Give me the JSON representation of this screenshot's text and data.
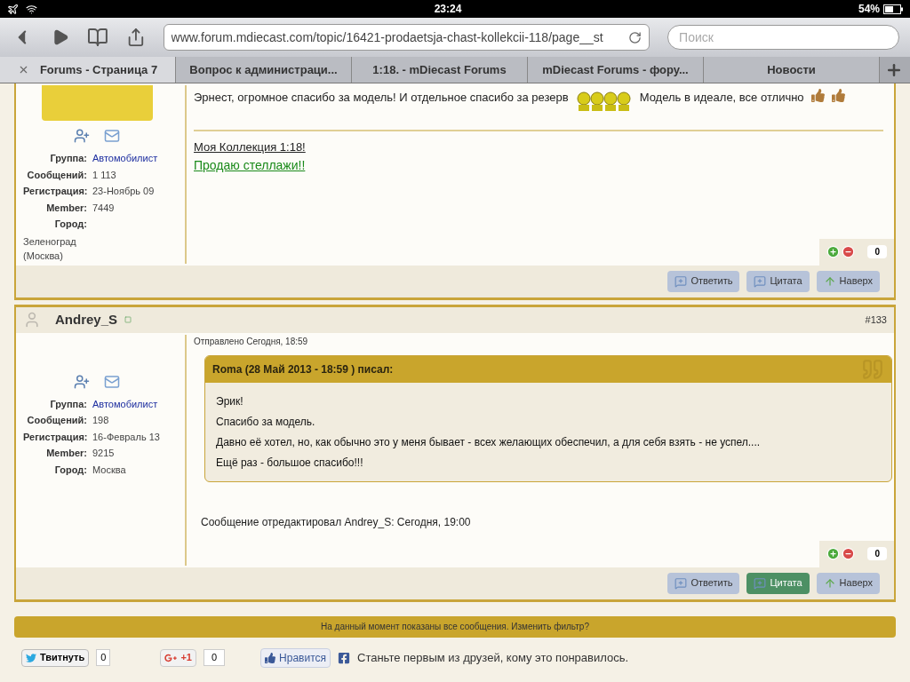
{
  "status_bar": {
    "time": "23:24",
    "battery": "54%"
  },
  "browser": {
    "url": "www.forum.mdiecast.com/topic/16421-prodaetsja-chast-kollekcii-118/page__st",
    "search_placeholder": "Поиск",
    "tabs": [
      {
        "label": "Forums - Страница 7",
        "selected": true
      },
      {
        "label": "Вопрос к администраци...",
        "selected": false
      },
      {
        "label": "1:18. - mDiecast Forums",
        "selected": false
      },
      {
        "label": "mDiecast Forums - фору...",
        "selected": false
      },
      {
        "label": "Новости",
        "selected": false
      }
    ]
  },
  "posts": [
    {
      "avatar_photo": true,
      "profile": [
        {
          "label": "Группа:",
          "value": "Автомобилист",
          "kind": "link"
        },
        {
          "label": "Сообщений:",
          "value": "1 113",
          "kind": "inline"
        },
        {
          "label": "Регистрация:",
          "value": "23-Ноябрь 09",
          "kind": "inline"
        },
        {
          "label": "Member:",
          "value": "7449",
          "kind": "inline"
        },
        {
          "label": "Город:",
          "value": "Зеленоград (Москва)",
          "kind": "block"
        }
      ],
      "body": [
        {
          "kind": "text",
          "text": "Эрнест, огромное спасибо за модель! И отдельное спасибо за резерв"
        },
        {
          "kind": "smiley"
        },
        {
          "kind": "text",
          "text": "Модель в идеале, все отлично"
        },
        {
          "kind": "thumbs"
        },
        {
          "kind": "thumbs"
        }
      ],
      "signature": [
        {
          "text": "Моя Коллекция 1:18!",
          "kind": "plain"
        },
        {
          "text": "Продаю стеллажи!!",
          "kind": "green"
        }
      ],
      "rating": "0",
      "buttons": [
        {
          "label": "Ответить",
          "kind": "reply",
          "selected": false
        },
        {
          "label": "Цитата",
          "kind": "quote",
          "selected": false
        },
        {
          "label": "Наверх",
          "kind": "top",
          "selected": false
        }
      ]
    },
    {
      "header": {
        "author": "Andrey_S",
        "number": "#133"
      },
      "profile": [
        {
          "label": "Группа:",
          "value": "Автомобилист",
          "kind": "link"
        },
        {
          "label": "Сообщений:",
          "value": "198",
          "kind": "inline"
        },
        {
          "label": "Регистрация:",
          "value": "16-Февраль 13",
          "kind": "inline"
        },
        {
          "label": "Member:",
          "value": "9215",
          "kind": "inline"
        },
        {
          "label": "Город:",
          "value": "Москва",
          "kind": "inline"
        }
      ],
      "posted": "Отправлено Сегодня, 18:59",
      "quote": {
        "title": "Roma (28 Май 2013 - 18:59 ) писал:",
        "lines": [
          "Эрик!",
          "Спасибо за модель.",
          "Давно её хотел, но, как обычно это у меня бывает - всех желающих обеспечил, а для себя взять - не успел....",
          "Ещё раз - большое спасибо!!!"
        ]
      },
      "edited": "Сообщение отредактировал Andrey_S: Сегодня, 19:00",
      "rating": "0",
      "buttons": [
        {
          "label": "Ответить",
          "kind": "reply",
          "selected": false
        },
        {
          "label": "Цитата",
          "kind": "quote",
          "selected": true
        },
        {
          "label": "Наверх",
          "kind": "top",
          "selected": false
        }
      ]
    }
  ],
  "filter_notice": "На данный момент показаны все сообщения. Изменить фильтр?",
  "social": {
    "tweet": {
      "label": "Твитнуть",
      "count": "0"
    },
    "gplus": {
      "label": "+1",
      "count": "0"
    },
    "like": {
      "label": "Нравится",
      "text": "Станьте первым из друзей, кому это понравилось."
    }
  }
}
